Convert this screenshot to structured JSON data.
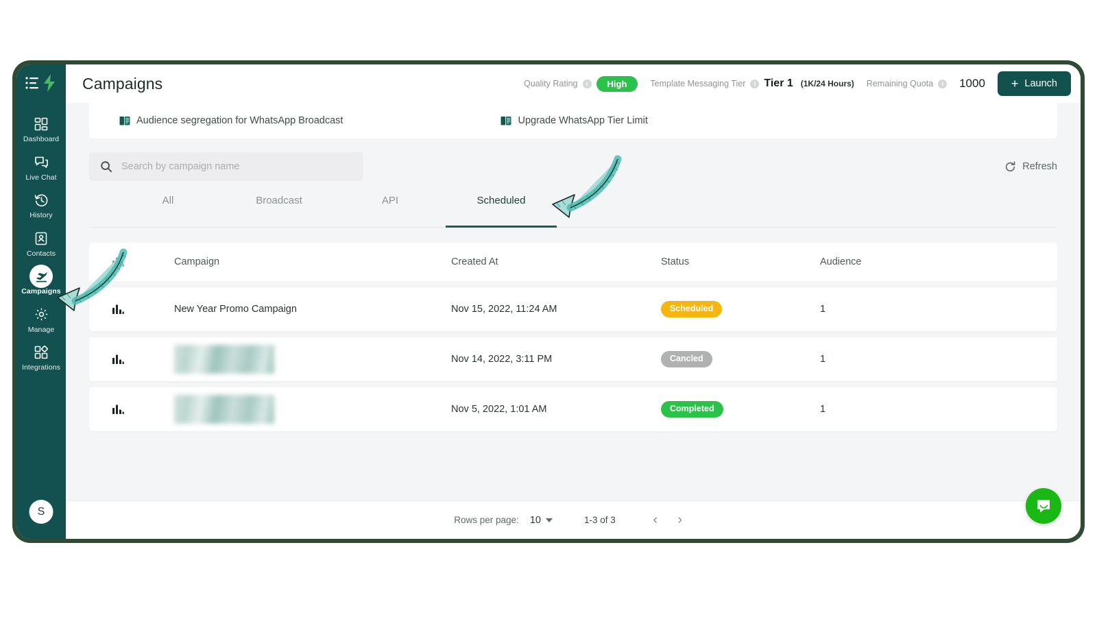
{
  "brand": {
    "logo_icon": "list-lightning-logo",
    "sidebar_color": "#12514f",
    "accent": "#11524f"
  },
  "sidebar": {
    "items": [
      {
        "label": "Dashboard",
        "icon": "dashboard-icon",
        "active": false
      },
      {
        "label": "Live Chat",
        "icon": "chat-icon",
        "active": false
      },
      {
        "label": "History",
        "icon": "history-icon",
        "active": false
      },
      {
        "label": "Contacts",
        "icon": "contacts-icon",
        "active": false
      },
      {
        "label": "Campaigns",
        "icon": "campaigns-icon",
        "active": true
      },
      {
        "label": "Manage",
        "icon": "gear-icon",
        "active": false
      },
      {
        "label": "Integrations",
        "icon": "integrations-icon",
        "active": false
      }
    ],
    "avatar_initial": "S"
  },
  "header": {
    "title": "Campaigns",
    "quality_rating_label": "Quality Rating",
    "quality_rating_value": "High",
    "quality_rating_color": "#2cc14b",
    "template_tier_label": "Template Messaging Tier",
    "tier_name": "Tier 1",
    "tier_detail": "(1K/24 Hours)",
    "remaining_quota_label": "Remaining Quota",
    "remaining_quota_value": "1000",
    "launch_label": "Launch",
    "launch_plus": "+",
    "info_glyph": "i"
  },
  "banner": {
    "links": [
      {
        "label": "Audience segregation for WhatsApp Broadcast",
        "icon": "book-icon"
      },
      {
        "label": "Upgrade WhatsApp Tier Limit",
        "icon": "book-icon"
      }
    ]
  },
  "toolbar": {
    "search_placeholder": "Search by campaign name",
    "search_value": "",
    "refresh_label": "Refresh"
  },
  "tabs": [
    {
      "label": "All",
      "active": false
    },
    {
      "label": "Broadcast",
      "active": false
    },
    {
      "label": "API",
      "active": false
    },
    {
      "label": "Scheduled",
      "active": true
    }
  ],
  "table": {
    "columns": [
      "",
      "Campaign",
      "Created At",
      "Status",
      "Audience"
    ],
    "rows": [
      {
        "icon": "bar-chart-icon",
        "campaign": "New Year Promo Campaign",
        "redacted": false,
        "created_at": "Nov 15, 2022, 11:24 AM",
        "status": "Scheduled",
        "status_color": "#f6b610",
        "audience": "1"
      },
      {
        "icon": "bar-chart-icon",
        "campaign": "",
        "redacted": true,
        "created_at": "Nov 14, 2022, 3:11 PM",
        "status": "Cancled",
        "status_color": "#b0b2b2",
        "audience": "1"
      },
      {
        "icon": "bar-chart-icon",
        "campaign": "",
        "redacted": true,
        "created_at": "Nov 5, 2022, 1:01 AM",
        "status": "Completed",
        "status_color": "#2bc24a",
        "audience": "1"
      }
    ]
  },
  "pagination": {
    "rows_per_page_label": "Rows per page:",
    "rows_per_page_value": "10",
    "range_label": "1-3 of 3",
    "prev_glyph": "‹",
    "next_glyph": "›"
  },
  "chat_widget": {
    "icon": "messenger-icon",
    "color": "#19b814"
  },
  "annotations": [
    {
      "name": "arrow-pointing-to-scheduled-tab",
      "color": "#a6ded7"
    },
    {
      "name": "arrow-pointing-to-campaigns-nav",
      "color": "#a6ded7"
    }
  ]
}
